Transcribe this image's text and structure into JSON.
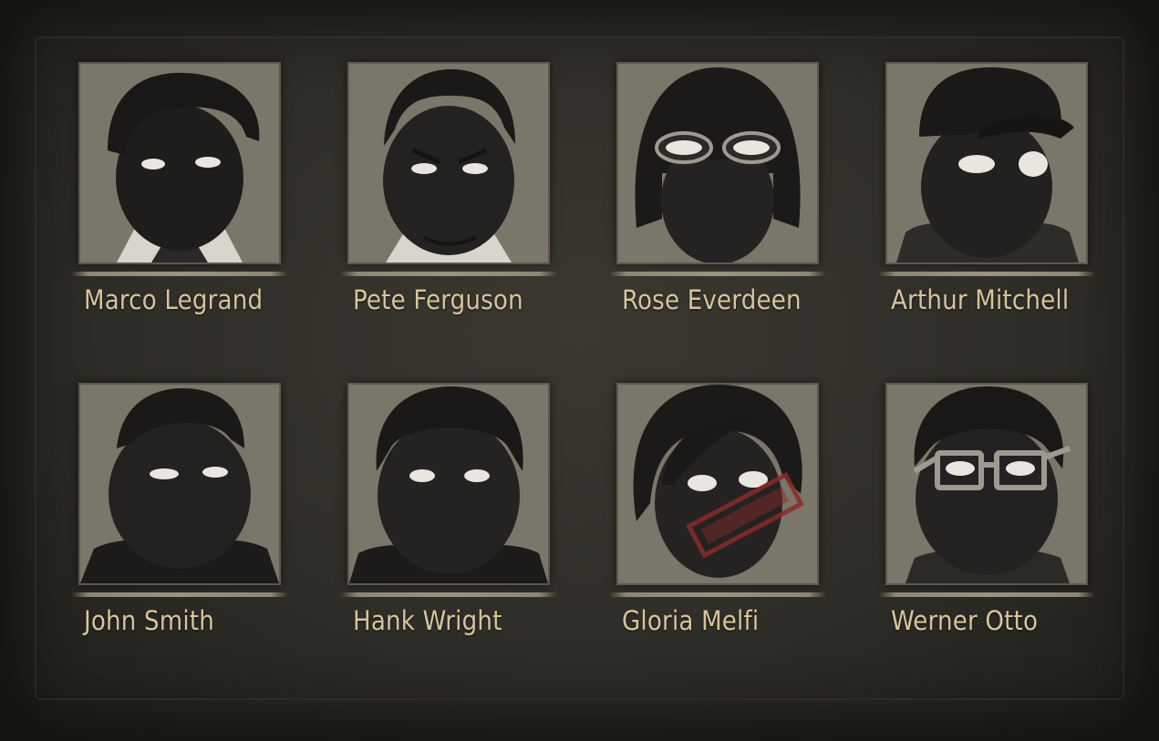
{
  "screen": "suspect-board",
  "colors": {
    "board": "#2f2d27",
    "portrait_bg": "#7a766a",
    "name_text": "#d6c59c",
    "silhouette": "#1e1d1b",
    "eyes": "#e8e6df",
    "stamp": "#8a2a2a"
  },
  "suspects": [
    {
      "name": "Marco Legrand",
      "icon": "suspect-portrait-slicked-hair"
    },
    {
      "name": "Pete Ferguson",
      "icon": "suspect-portrait-receding-hair"
    },
    {
      "name": "Rose Everdeen",
      "icon": "suspect-portrait-bob-goggles"
    },
    {
      "name": "Arthur Mitchell",
      "icon": "suspect-portrait-cap"
    },
    {
      "name": "John Smith",
      "icon": "suspect-portrait-short-hair"
    },
    {
      "name": "Hank Wright",
      "icon": "suspect-portrait-crew-cut"
    },
    {
      "name": "Gloria Melfi",
      "icon": "suspect-portrait-stamped",
      "stamped": true
    },
    {
      "name": "Werner Otto",
      "icon": "suspect-portrait-glasses"
    }
  ]
}
